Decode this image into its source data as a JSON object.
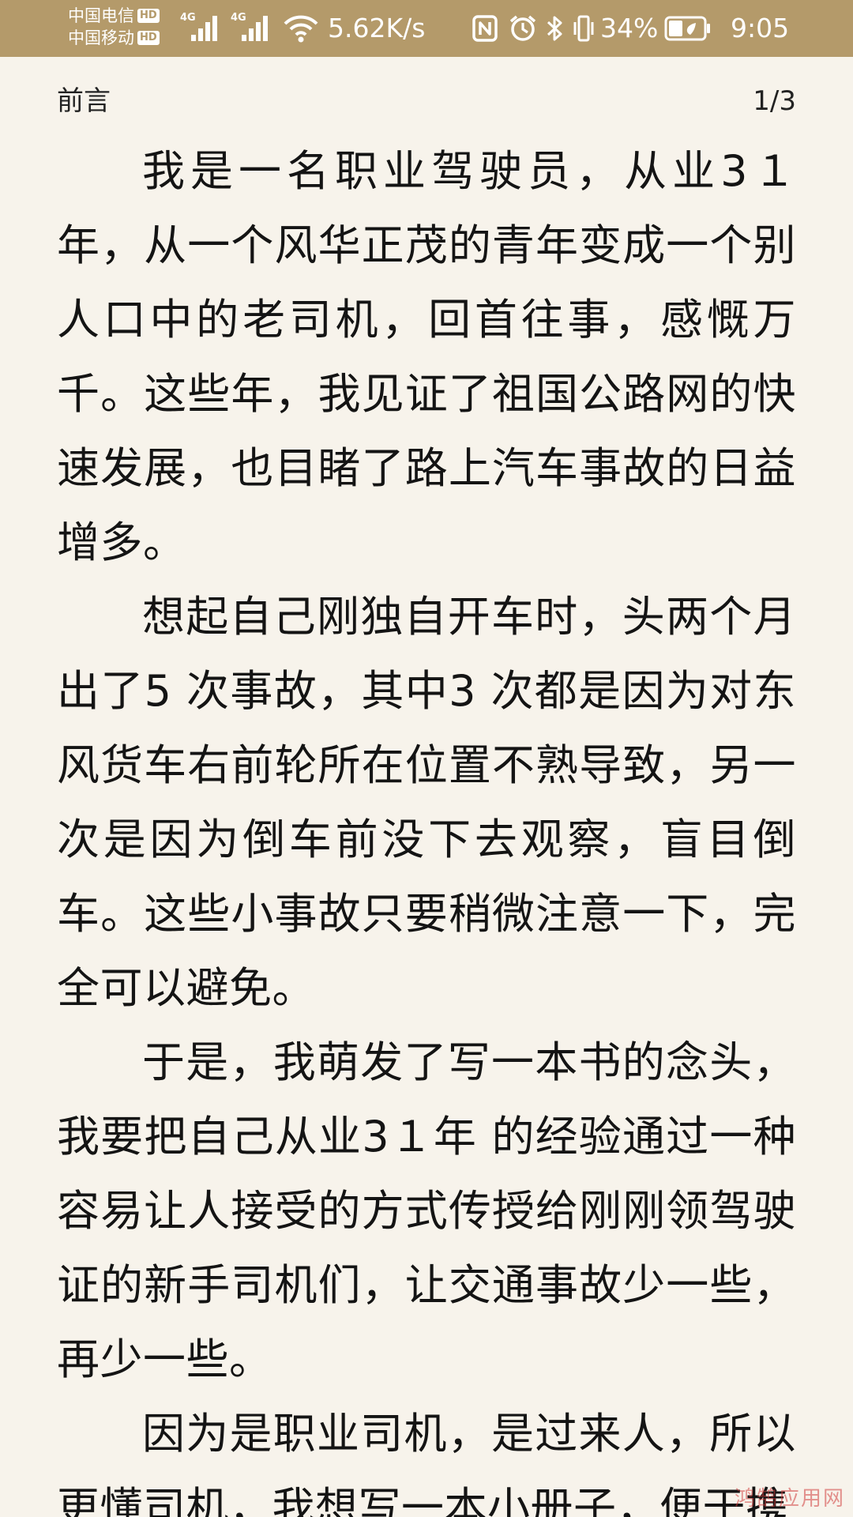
{
  "status_bar": {
    "carrier_1": "中国电信",
    "carrier_2": "中国移动",
    "hd_label": "HD",
    "network_1": "4G",
    "network_2": "4G",
    "net_speed": "5.62K/s",
    "battery_percent": "34%",
    "time": "9:05",
    "icons": [
      "nfc-icon",
      "alarm-icon",
      "bluetooth-icon",
      "vibrate-icon",
      "battery-icon",
      "wifi-icon",
      "signal-icon"
    ],
    "background_color": "#b49a6a"
  },
  "reader": {
    "chapter_title": "前言",
    "page_indicator": "1/3",
    "paragraphs": [
      "我是一名职业驾驶员，从业3１年，从一个风华正茂的青年变成一个别人口中的老司机，回首往事，感慨万千。这些年，我见证了祖国公路网的快速发展，也目睹了路上汽车事故的日益增多。",
      "想起自己刚独自开车时，头两个月出了5 次事故，其中3 次都是因为对东风货车右前轮所在位置不熟导致，另一次是因为倒车前没下去观察，盲目倒车。这些小事故只要稍微注意一下，完全可以避免。",
      "于是，我萌发了写一本书的念头，我要把自己从业3１年 的经验通过一种容易让人接受的方式传授给刚刚领驾驶证的新手司机们，让交通事故少一些，再少一些。",
      "因为是职业司机，是过来人，所以更懂司机，我想写一本小册子，便于携"
    ],
    "background_color": "#f7f3eb",
    "text_color": "#141414"
  },
  "watermark": "鸿鹄应用网"
}
